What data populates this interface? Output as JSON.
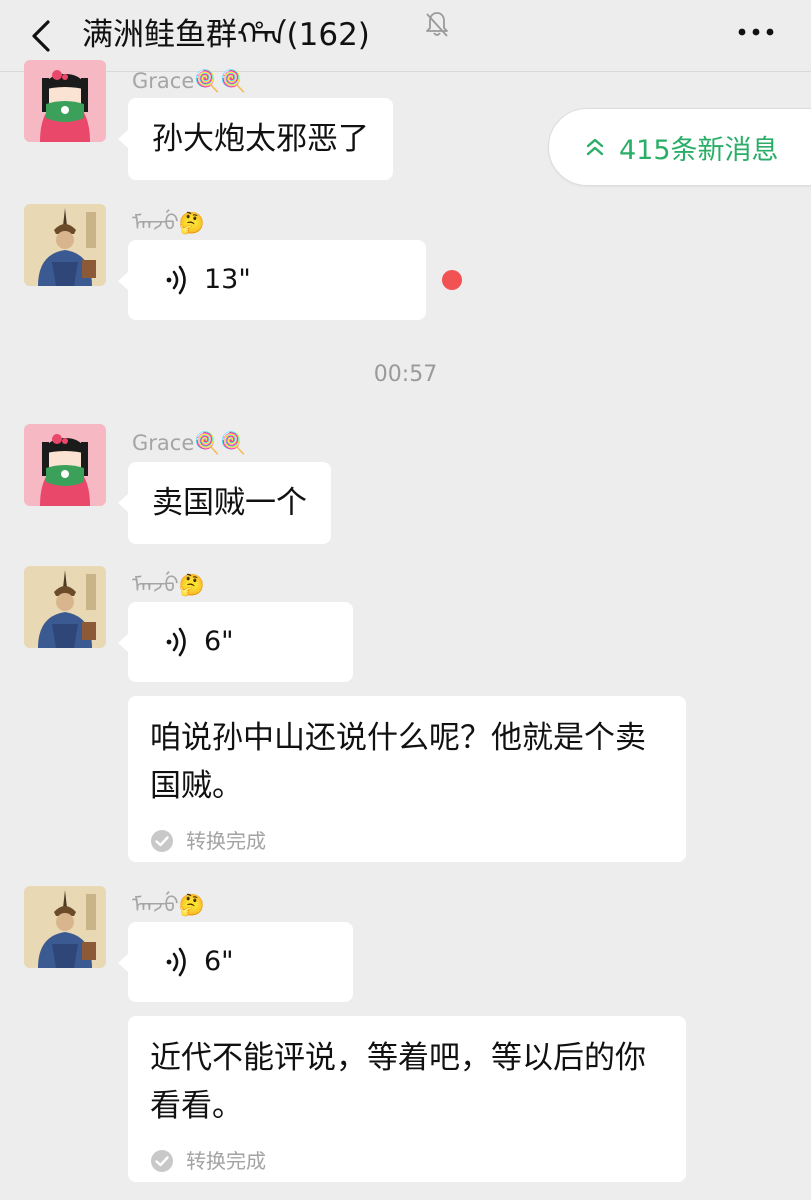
{
  "header": {
    "title": "满洲鲑鱼群ᡥᠠᠨ(162)"
  },
  "new_messages_pill": {
    "label": "415条新消息",
    "accent": "#2aae67"
  },
  "timestamp": "00:57",
  "messages": [
    {
      "sender": "Grace🍭🍭",
      "type": "text",
      "text": "孙大炮太邪恶了"
    },
    {
      "sender": "ᠮᠠᠨᠵᡠ🤔",
      "type": "voice",
      "duration": "13\"",
      "unread": true
    },
    {
      "sender": "Grace🍭🍭",
      "type": "text",
      "text": "卖国贼一个"
    },
    {
      "sender": "ᠮᠠᠨᠵᡠ🤔",
      "type": "voice",
      "duration": "6\"",
      "conversion": {
        "text": "咱说孙中山还说什么呢？他就是个卖国贼。",
        "status": "转换完成"
      }
    },
    {
      "sender": "ᠮᠠᠨᠵᡠ🤔",
      "type": "voice",
      "duration": "6\"",
      "conversion": {
        "text": "近代不能评说，等着吧，等以后的你看看。",
        "status": "转换完成"
      }
    }
  ],
  "colors": {
    "background": "#ededed",
    "bubble": "#ffffff",
    "unread_dot": "#f25252",
    "nick": "#a5a5a5"
  },
  "icons": [
    "back-arrow-icon",
    "mute-bell-icon",
    "more-icon",
    "voice-wave-icon",
    "check-circle-icon",
    "double-chevron-up-icon"
  ]
}
